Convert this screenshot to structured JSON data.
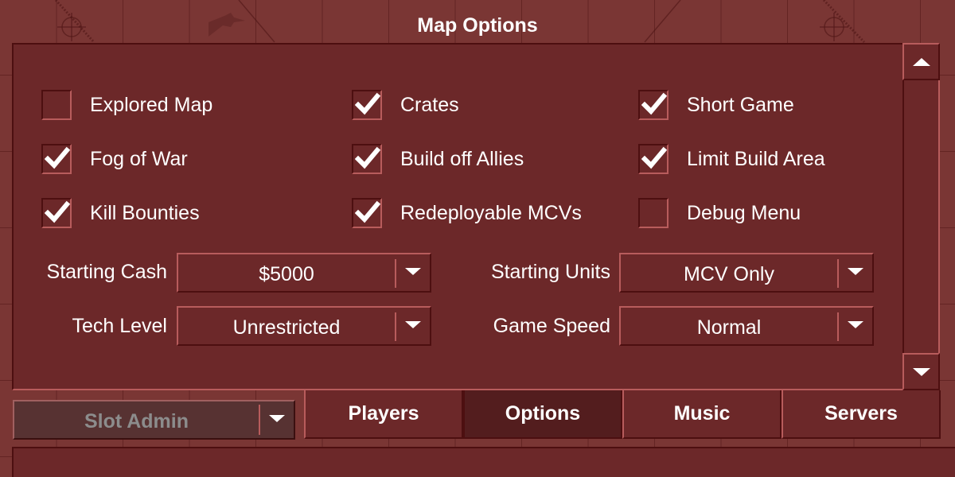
{
  "title": "Map Options",
  "checkboxes": [
    {
      "label": "Explored Map",
      "checked": false
    },
    {
      "label": "Crates",
      "checked": true
    },
    {
      "label": "Short Game",
      "checked": true
    },
    {
      "label": "Fog of War",
      "checked": true
    },
    {
      "label": "Build off Allies",
      "checked": true
    },
    {
      "label": "Limit Build Area",
      "checked": true
    },
    {
      "label": "Kill Bounties",
      "checked": true
    },
    {
      "label": "Redeployable MCVs",
      "checked": true
    },
    {
      "label": "Debug Menu",
      "checked": false
    }
  ],
  "dropdowns": [
    {
      "label": "Starting Cash",
      "value": "$5000"
    },
    {
      "label": "Starting Units",
      "value": "MCV Only"
    },
    {
      "label": "Tech Level",
      "value": "Unrestricted"
    },
    {
      "label": "Game Speed",
      "value": "Normal"
    }
  ],
  "slot_admin": {
    "label": "Slot Admin",
    "disabled": true
  },
  "tabs": [
    {
      "label": "Players",
      "active": false
    },
    {
      "label": "Options",
      "active": true
    },
    {
      "label": "Music",
      "active": false
    },
    {
      "label": "Servers",
      "active": false
    }
  ],
  "icons": {
    "check": "checkmark-icon",
    "dropdown": "triangle-down-icon",
    "scroll_up": "triangle-up-icon",
    "scroll_down": "triangle-down-icon"
  },
  "colors": {
    "panel": "#6c2829",
    "background": "#7a3634",
    "highlight": "#b85c5c",
    "shadow": "#4d0f10",
    "active_tab": "#531d1e",
    "disabled_text": "#8c8c8c"
  }
}
